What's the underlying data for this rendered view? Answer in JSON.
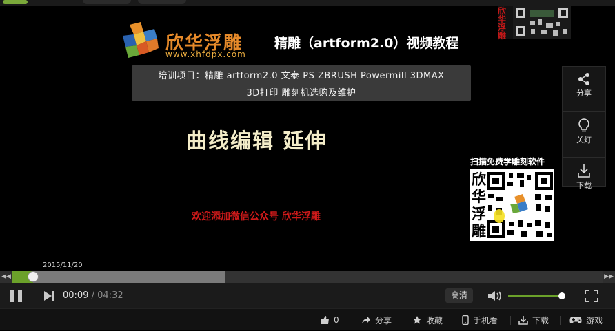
{
  "video": {
    "logo_name": "欣华浮雕",
    "logo_url": "www.xhfdpx.com",
    "course_title": "精雕（artform2.0）视频教程",
    "corner_brand": "欣华浮雕",
    "banner_line1": "培训项目：精雕 artform2.0 文泰 PS ZBRUSH Powermill 3DMAX",
    "banner_line2": "3D打印 雕刻机选购及维护",
    "heading": "曲线编辑 延伸",
    "follow_text": "欢迎添加微信公众号 欣华浮雕",
    "qr_caption": "扫描免费学雕刻软件",
    "qr_text": "欣华浮雕",
    "date": "2015/11/20",
    "colors": {
      "logo_orange": "#e68a2a",
      "follow_red": "#d01a1a",
      "heading_cream": "#f3ecc8"
    }
  },
  "side_panel": {
    "share": {
      "label": "分享",
      "icon": "share-icon"
    },
    "lights": {
      "label": "关灯",
      "icon": "lightbulb-icon"
    },
    "download": {
      "label": "下载",
      "icon": "download-icon"
    }
  },
  "player": {
    "current_time": "00:09",
    "separator": "/",
    "total_time": "04:32",
    "played_fraction": 0.035,
    "buffered_fraction": 0.36,
    "quality_label": "高清",
    "volume_fraction": 0.95,
    "accent_color": "#6ba12a",
    "prev_arrow": "◀◀",
    "next_arrow": "▶▶"
  },
  "bottom_bar": {
    "like_count": "0",
    "share_label": "分享",
    "favorite_label": "收藏",
    "mobile_label": "手机看",
    "download_label": "下载",
    "games_label": "游戏"
  }
}
